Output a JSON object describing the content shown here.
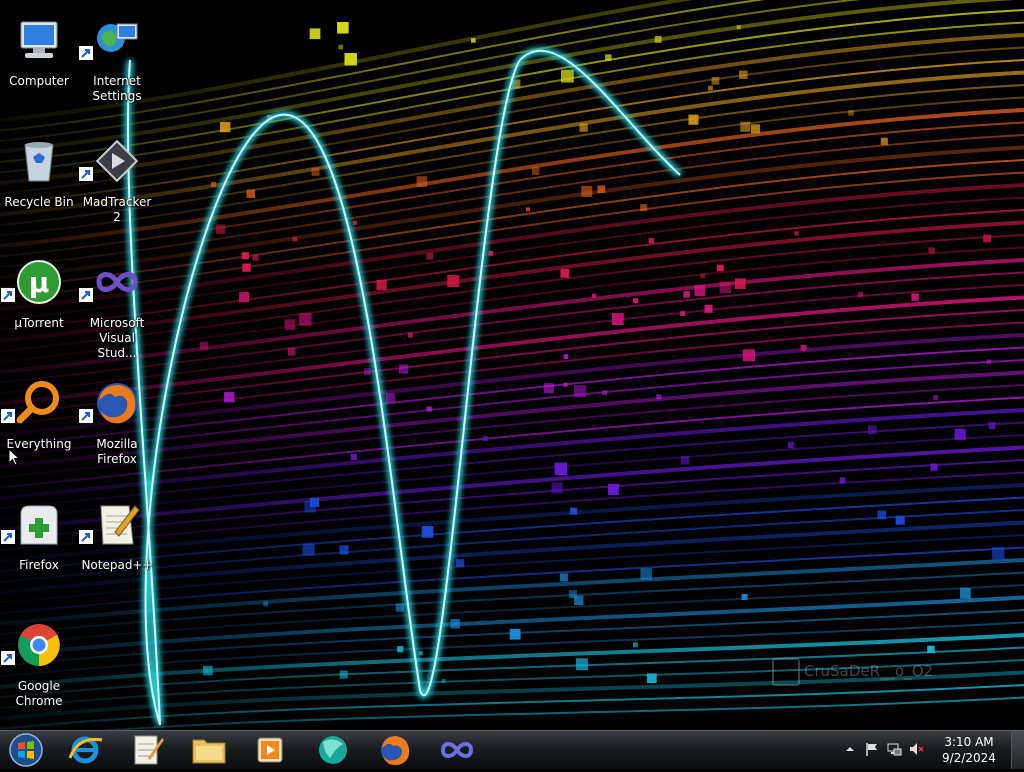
{
  "desktop": {
    "icons": [
      {
        "label": "Computer",
        "icon": "computer-icon"
      },
      {
        "label": "Internet Settings",
        "icon": "internet-settings-icon"
      },
      {
        "label": "Recycle Bin",
        "icon": "recycle-bin-icon"
      },
      {
        "label": "MadTracker 2",
        "icon": "madtracker-icon"
      },
      {
        "label": "µTorrent",
        "icon": "utorrent-icon"
      },
      {
        "label": "Microsoft Visual Stud...",
        "icon": "visual-studio-icon"
      },
      {
        "label": "Everything",
        "icon": "everything-search-icon"
      },
      {
        "label": "Mozilla Firefox",
        "icon": "firefox-icon"
      },
      {
        "label": "Firefox",
        "icon": "firefox-profile-icon"
      },
      {
        "label": "Notepad++",
        "icon": "notepad-plus-plus-icon"
      },
      {
        "label": "Google Chrome",
        "icon": "chrome-icon"
      }
    ],
    "watermark": "CruSaDeR__o_O2"
  },
  "taskbar": {
    "start_icon": "windows-start-icon",
    "pinned": [
      {
        "icon": "internet-explorer-icon"
      },
      {
        "icon": "notepad-icon"
      },
      {
        "icon": "file-explorer-icon"
      },
      {
        "icon": "media-player-icon"
      },
      {
        "icon": "web-browser-icon"
      },
      {
        "icon": "firefox-icon"
      },
      {
        "icon": "visual-studio-icon"
      }
    ],
    "tray": {
      "time": "3:10 AM",
      "date": "9/2/2024",
      "icons": [
        "show-hidden-icons-arrow",
        "action-center-flag-icon",
        "network-icon",
        "volume-muted-icon"
      ]
    }
  },
  "colors": {
    "taskbar_bg": "#1a1d21",
    "neon_cyan": "#2fd7e6",
    "wallpaper_magenta": "#d6157a",
    "wallpaper_yellow": "#d6d61a"
  }
}
